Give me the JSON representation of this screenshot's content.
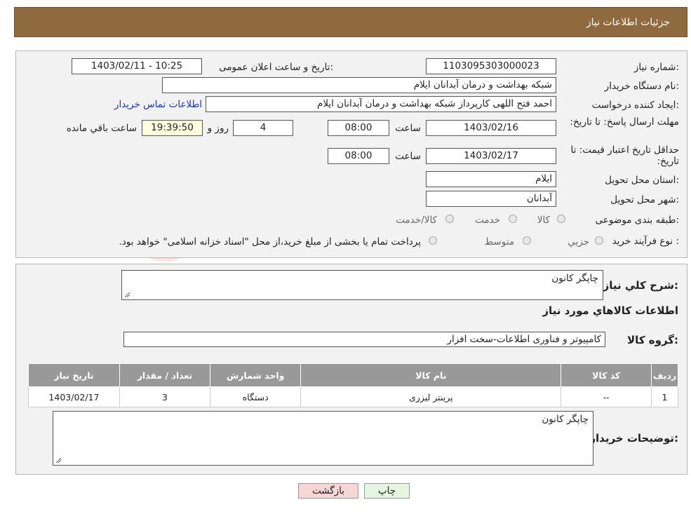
{
  "header": {
    "title": "جزئیات اطلاعات نیاز"
  },
  "form": {
    "need_number_label": "شماره نیاز:",
    "need_number": "1103095303000023",
    "announce_label": "تاریخ و ساعت اعلان عمومی:",
    "announce_value": "1403/02/11 - 10:25",
    "buyer_org_label": "نام دستگاه خریدار:",
    "buyer_org": "شبکه بهداشت و درمان آبدانان ایلام",
    "creator_label": "ایجاد کننده درخواست:",
    "creator": "احمد فتح اللهی کارپرداز شبکه بهداشت و درمان آبدانان ایلام",
    "contact_link": "اطلاعات تماس خریدار",
    "deadline_label": "مهلت ارسال پاسخ: تا تاریخ:",
    "deadline_date": "1403/02/16",
    "time_label": "ساعت",
    "deadline_time": "08:00",
    "days_value": "4",
    "days_label": "روز و",
    "remaining_time": "19:39:50",
    "remaining_label": "ساعت باقي مانده",
    "validity_label": "حداقل تاریخ اعتبار قیمت: تا تاریخ:",
    "validity_date": "1403/02/17",
    "validity_time": "08:00",
    "province_label": "استان محل تحویل:",
    "province": "ایلام",
    "city_label": "شهر محل تحویل:",
    "city": "آبدانان",
    "category_label": "طبقه بندی موضوعی:",
    "category_options": [
      "کالا",
      "خدمت",
      "کالا/خدمت"
    ],
    "process_label": "نوع فرآیند خرید :",
    "process_options": [
      "جزيي",
      "متوسط"
    ],
    "process_note": "پرداخت تمام یا بخشی از مبلغ خرید،از محل \"اسناد خزانه اسلامی\" خواهد بود."
  },
  "details": {
    "summary_label": "شرح کلي نياز:",
    "summary": "چاپگر کانون",
    "goods_info_title": "اطلاعات کالاهاي مورد نياز",
    "group_label": "گروه کالا:",
    "group": "کامپیوتر و فناوری اطلاعات-سخت افزار",
    "table_headers": [
      "ردیف",
      "کد کالا",
      "نام کالا",
      "واحد شمارش",
      "تعداد / مقدار",
      "تاریخ نیاز"
    ],
    "rows": [
      {
        "row": "1",
        "code": "--",
        "name": "پرینتر لیزری",
        "unit": "دستگاه",
        "qty": "3",
        "date": "1403/02/17"
      }
    ],
    "buyer_notes_label": "توضیحات خریدار:",
    "buyer_notes": "چاپگر کانون"
  },
  "buttons": {
    "print": "چاپ",
    "back": "بازگشت"
  },
  "colors": {
    "header_bg": "#8f6a3f",
    "link": "#1a33cc",
    "back_btn": "#f7d6d6",
    "print_btn": "#e6f5e0"
  }
}
